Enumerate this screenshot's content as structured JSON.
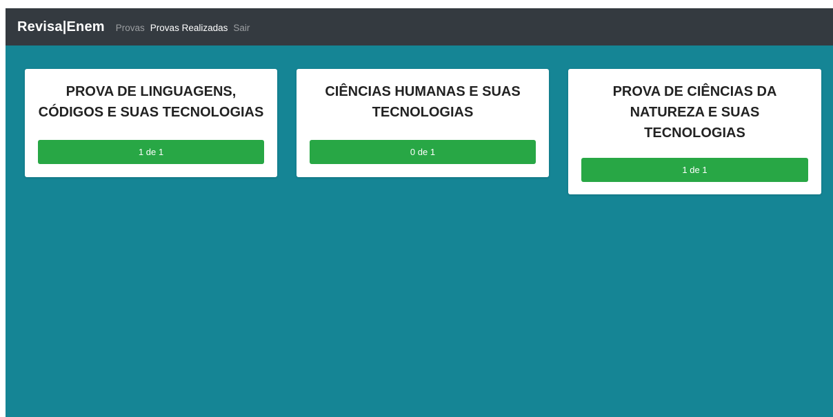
{
  "navbar": {
    "brand": "Revisa|Enem",
    "links": [
      {
        "label": "Provas"
      },
      {
        "label": "Provas Realizadas"
      },
      {
        "label": "Sair"
      }
    ]
  },
  "cards": [
    {
      "title": "PROVA DE LINGUAGENS, CÓDIGOS E SUAS TECNOLOGIAS",
      "progress": "1 de 1"
    },
    {
      "title": "CIÊNCIAS HUMANAS E SUAS TECNOLOGIAS",
      "progress": "0 de 1"
    },
    {
      "title": "PROVA DE CIÊNCIAS DA NATUREZA E SUAS TECNOLOGIAS",
      "progress": "1 de 1"
    }
  ],
  "colors": {
    "navbar": "#343a40",
    "background": "#158595",
    "button": "#28a745",
    "card": "#ffffff"
  }
}
